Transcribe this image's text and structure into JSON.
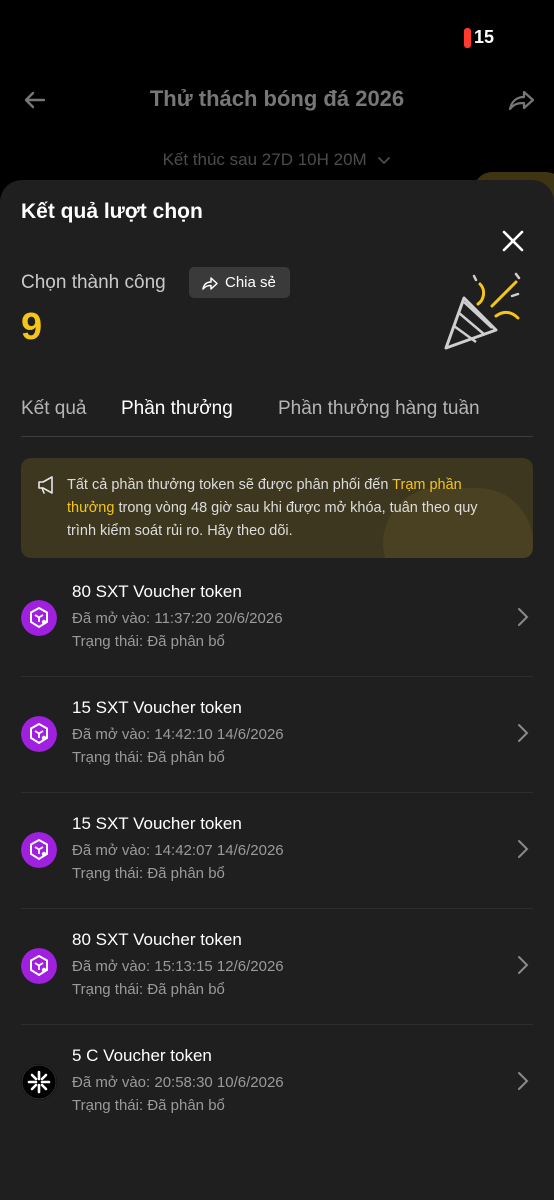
{
  "status_bar": {
    "battery": "15"
  },
  "page": {
    "title": "Thử thách bóng đá 2026",
    "countdown": "Kết thúc sau 27D 10H 20M"
  },
  "sheet": {
    "title": "Kết quả lượt chọn",
    "success_label": "Chọn thành công",
    "share_label": "Chia sẻ",
    "success_count": "9",
    "tabs": [
      {
        "label": "Kết quả",
        "active": false
      },
      {
        "label": "Phần thưởng",
        "active": true
      },
      {
        "label": "Phần thưởng hàng tuần",
        "active": false
      }
    ],
    "notice": {
      "text_before": "Tất cả phần thưởng token sẽ được phân phối đến ",
      "link": "Trạm phần thưởng",
      "text_after": " trong vòng 48 giờ sau khi được mở khóa, tuân theo quy trình kiểm soát rủi ro. Hãy theo dõi."
    },
    "rewards": [
      {
        "title": "80 SXT Voucher token",
        "opened": "Đã mở vào: 11:37:20 20/6/2026",
        "status": "Trạng thái: Đã phân bổ",
        "icon": "sxt-token-icon"
      },
      {
        "title": "15 SXT Voucher token",
        "opened": "Đã mở vào: 14:42:10 14/6/2026",
        "status": "Trạng thái: Đã phân bổ",
        "icon": "sxt-token-icon"
      },
      {
        "title": "15 SXT Voucher token",
        "opened": "Đã mở vào: 14:42:07 14/6/2026",
        "status": "Trạng thái: Đã phân bổ",
        "icon": "sxt-token-icon"
      },
      {
        "title": "80 SXT Voucher token",
        "opened": "Đã mở vào: 15:13:15 12/6/2026",
        "status": "Trạng thái: Đã phân bổ",
        "icon": "sxt-token-icon"
      },
      {
        "title": "5 C Voucher token",
        "opened": "Đã mở vào: 20:58:30 10/6/2026",
        "status": "Trạng thái: Đã phân bổ",
        "icon": "c-token-icon"
      }
    ]
  },
  "colors": {
    "accent": "#f5c518",
    "sheet_bg": "#1f1f1f",
    "notice_bg": "#3d3720",
    "sxt_token": "#a020e0",
    "battery_low": "#ff3b30"
  }
}
